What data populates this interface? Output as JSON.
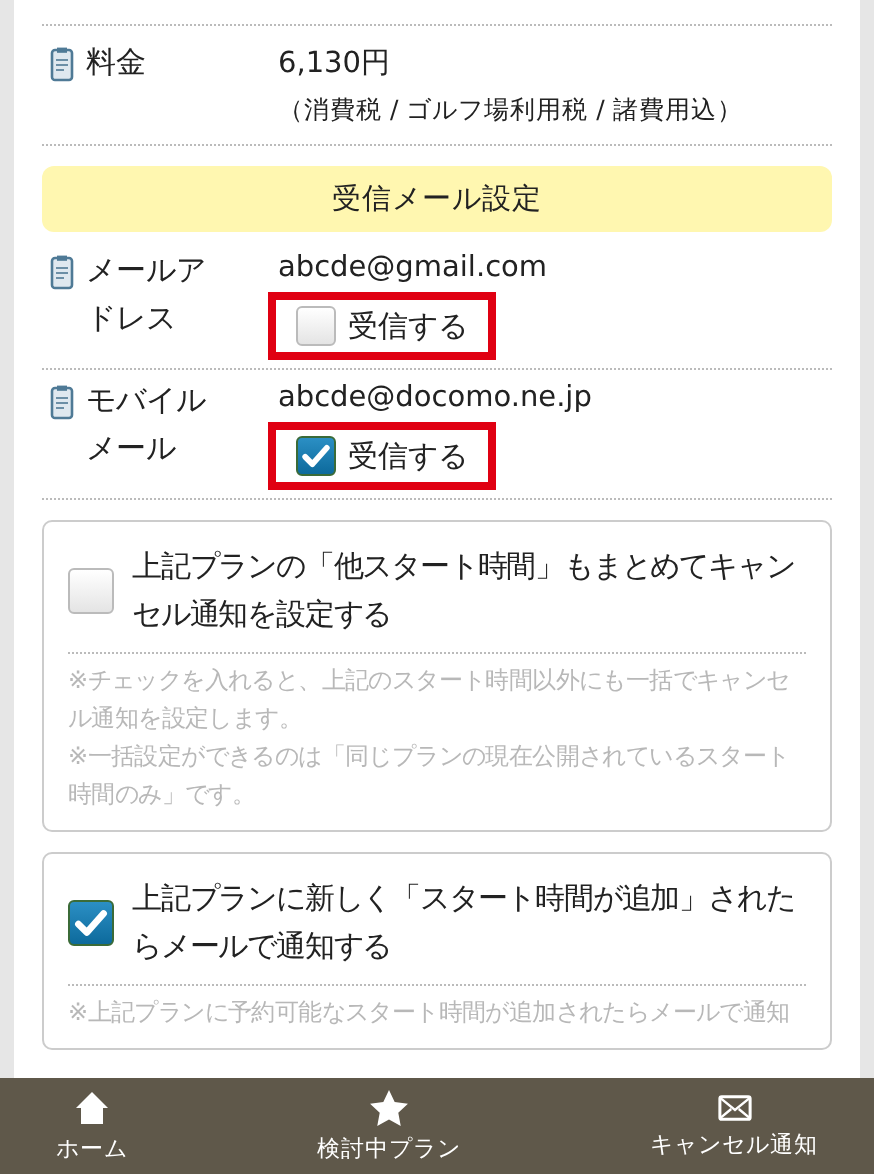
{
  "fee": {
    "label": "料金",
    "value": "6,130円",
    "note": "（消費税 / ゴルフ場利用税 / 諸費用込）"
  },
  "mail_settings": {
    "title": "受信メール設定",
    "rows": [
      {
        "label": "メールアドレス",
        "address": "abcde@gmail.com",
        "option": "受信する",
        "checked": false
      },
      {
        "label": "モバイルメール",
        "address": "abcde@docomo.ne.jp",
        "option": "受信する",
        "checked": true
      }
    ]
  },
  "options": [
    {
      "label": "上記プランの「他スタート時間」もまとめてキャンセル通知を設定する",
      "checked": false,
      "notes": [
        "※チェックを入れると、上記のスタート時間以外にも一括でキャンセル通知を設定します。",
        "※一括設定ができるのは「同じプランの現在公開されているスタート時間のみ」です。"
      ]
    },
    {
      "label": "上記プランに新しく「スタート時間が追加」されたらメールで通知する",
      "checked": true,
      "notes": [
        "※上記プランに予約可能なスタート時間が追加されたらメールで通知"
      ]
    }
  ],
  "nav": [
    {
      "label": "ホーム"
    },
    {
      "label": "検討中プラン"
    },
    {
      "label": "キャンセル通知"
    }
  ]
}
